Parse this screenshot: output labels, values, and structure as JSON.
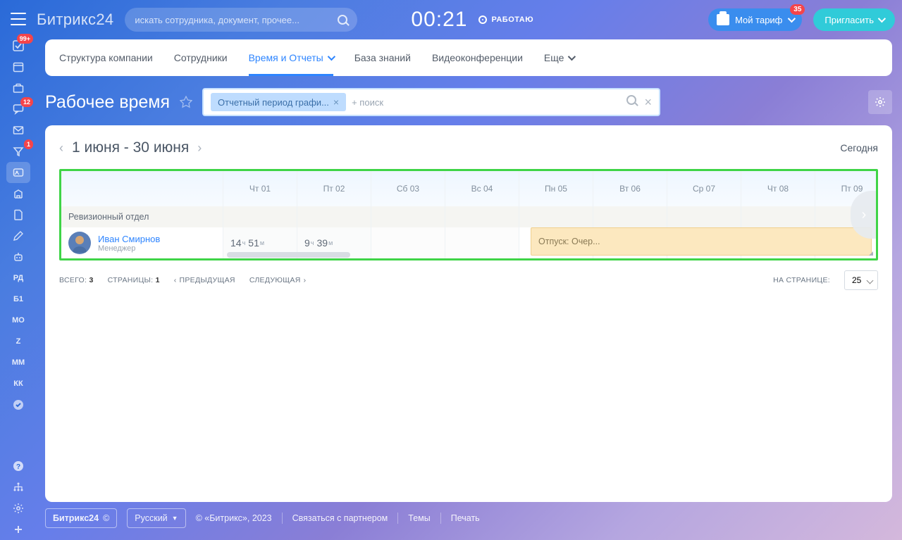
{
  "logo": {
    "a": "Битрикс",
    "b": "24"
  },
  "search_placeholder": "искать сотрудника, документ, прочее...",
  "clock": "00:21",
  "working": "РАБОТАЮ",
  "tariff": {
    "label": "Мой тариф",
    "badge": "35"
  },
  "invite": "Пригласить",
  "rail": {
    "tasks_badge": "99+",
    "chat_badge": "12",
    "mail_badge": "1",
    "labels": [
      "РД",
      "Б1",
      "МО",
      "Z",
      "ММ",
      "КК"
    ]
  },
  "tabs": [
    "Структура компании",
    "Сотрудники",
    "Время и Отчеты",
    "База знаний",
    "Видеоконференции",
    "Еще"
  ],
  "page_title": "Рабочее время",
  "filter": {
    "chip": "Отчетный период графи...",
    "placeholder": "+ поиск"
  },
  "period": {
    "range": "1 июня - 30 июня",
    "today": "Сегодня"
  },
  "days": [
    "Чт 01",
    "Пт 02",
    "Сб 03",
    "Вс 04",
    "Пн 05",
    "Вт 06",
    "Ср 07",
    "Чт 08",
    "Пт 09"
  ],
  "dept": "Ревизионный отдел",
  "emp": {
    "name": "Иван Смирнов",
    "role": "Менеджер"
  },
  "cells": {
    "d0": {
      "h": "14",
      "m": "51"
    },
    "d1": {
      "h": "9",
      "m": "39"
    }
  },
  "vac": "Отпуск: Очер...",
  "pager": {
    "total_l": "ВСЕГО:",
    "total": "3",
    "pages_l": "СТРАНИЦЫ:",
    "pages": "1",
    "prev": "ПРЕДЫДУЩАЯ",
    "next": "СЛЕДУЮЩАЯ",
    "per_l": "НА СТРАНИЦЕ:",
    "per": "25"
  },
  "footer": {
    "brand": "Битрикс24",
    "cloud": "©",
    "lang": "Русский",
    "copy": "© «Битрикс», 2023",
    "partner": "Связаться с партнером",
    "themes": "Темы",
    "print": "Печать"
  },
  "units": {
    "h": "ч",
    "m": "м"
  }
}
